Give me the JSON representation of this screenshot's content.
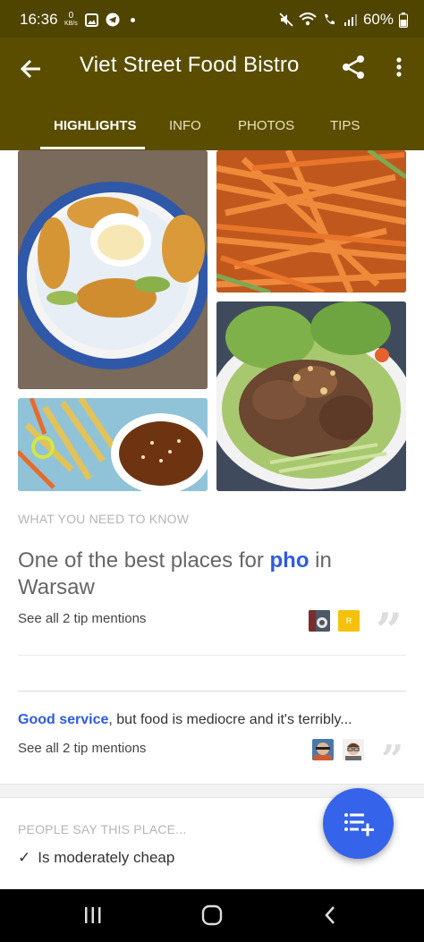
{
  "status": {
    "time": "16:36",
    "speed": "0 KB/s",
    "battery": "60%"
  },
  "appbar": {
    "title": "Viet Street Food Bistro",
    "back_icon": "arrow-back-icon",
    "share_icon": "share-icon",
    "more_icon": "more-vert-icon"
  },
  "tabs": [
    {
      "label": "HIGHLIGHTS",
      "active": true
    },
    {
      "label": "INFO",
      "active": false
    },
    {
      "label": "PHOTOS",
      "active": false
    },
    {
      "label": "TIPS",
      "active": false
    }
  ],
  "photos": [
    "Spiral potato sticks around dipping sauce on blue-rimmed plate",
    "Shredded carrot and cucumber salad",
    "Fried spring rolls with sesame dipping sauce",
    "Beef noodle salad with peanuts and herbs"
  ],
  "what_you_need": {
    "label": "WHAT YOU NEED TO KNOW",
    "tip1": {
      "prefix": "One of the best places for ",
      "highlight": "pho",
      "suffix": " in Warsaw",
      "mentions": "See all 2 tip mentions",
      "avatar_letter": "R"
    },
    "tip2": {
      "highlight": "Good service",
      "suffix": ", but food is mediocre and it's terribly...",
      "mentions": "See all 2 tip mentions"
    }
  },
  "people_say": {
    "label": "PEOPLE SAY THIS PLACE...",
    "items": [
      "Is moderately cheap"
    ]
  },
  "fab_icon": "add-to-list-icon",
  "colors": {
    "appbar": "#5a4d00",
    "statusbar": "#4f4400",
    "accent": "#2d5be3",
    "fab": "#3563e9"
  }
}
